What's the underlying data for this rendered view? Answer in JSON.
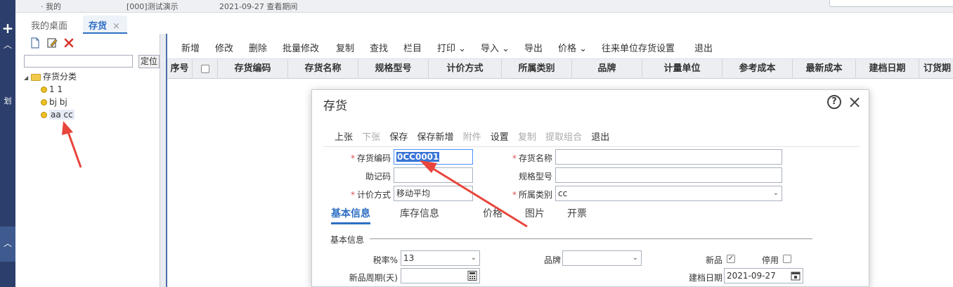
{
  "topbar": {
    "text1": "· 我的",
    "text2": "[000]测试演示",
    "text3": "2021-09-27 查看期间"
  },
  "tabs": [
    {
      "label": "我的桌面"
    },
    {
      "label": "存货",
      "close": "×"
    }
  ],
  "leftnav": {
    "plus": "+",
    "char": "划"
  },
  "tree": {
    "locate_label": "定位",
    "search_value": "",
    "root": "存货分类",
    "items": [
      "1 1",
      "bj bj",
      "aa cc"
    ]
  },
  "toolbar": {
    "items": [
      "新增",
      "修改",
      "删除",
      "批量修改",
      "复制",
      "查找",
      "栏目",
      "打印",
      "导入",
      "导出",
      "价格",
      "往来单位存货设置",
      "退出"
    ]
  },
  "grid": {
    "columns": [
      "序号",
      "",
      "存货编码",
      "存货名称",
      "规格型号",
      "计价方式",
      "所属类别",
      "品牌",
      "计量单位",
      "参考成本",
      "最新成本",
      "建档日期",
      "订货期"
    ]
  },
  "modal": {
    "title": "存货",
    "help": "?",
    "close": "×",
    "toolbar": [
      {
        "label": "上张",
        "enabled": true
      },
      {
        "label": "下张",
        "enabled": false
      },
      {
        "label": "保存",
        "enabled": true
      },
      {
        "label": "保存新增",
        "enabled": true
      },
      {
        "label": "附件",
        "enabled": false
      },
      {
        "label": "设置",
        "enabled": true
      },
      {
        "label": "复制",
        "enabled": false
      },
      {
        "label": "提取组合",
        "enabled": false
      },
      {
        "label": "退出",
        "enabled": true
      }
    ],
    "fields": {
      "code_label": "存货编码",
      "code_value": "0CC0001",
      "name_label": "存货名称",
      "name_value": "",
      "mnemonic_label": "助记码",
      "mnemonic_value": "",
      "spec_label": "规格型号",
      "spec_value": "",
      "pricing_label": "计价方式",
      "pricing_value": "移动平均",
      "category_label": "所属类别",
      "category_value": "cc"
    },
    "tabs": [
      "基本信息",
      "库存信息",
      "价格",
      "图片",
      "开票"
    ],
    "section_title": "基本信息",
    "basic": {
      "tax_label": "税率%",
      "tax_value": "13",
      "brand_label": "品牌",
      "brand_value": "",
      "new_label": "新品",
      "new_checked": true,
      "disabled_label": "停用",
      "disabled_checked": false,
      "period_label": "新品周期(天)",
      "period_value": "",
      "date_label": "建档日期",
      "date_value": "2021-09-27"
    }
  },
  "colors": {
    "accent": "#2e6fc4",
    "nav": "#2c3e6b",
    "annotation": "#e8453c"
  }
}
